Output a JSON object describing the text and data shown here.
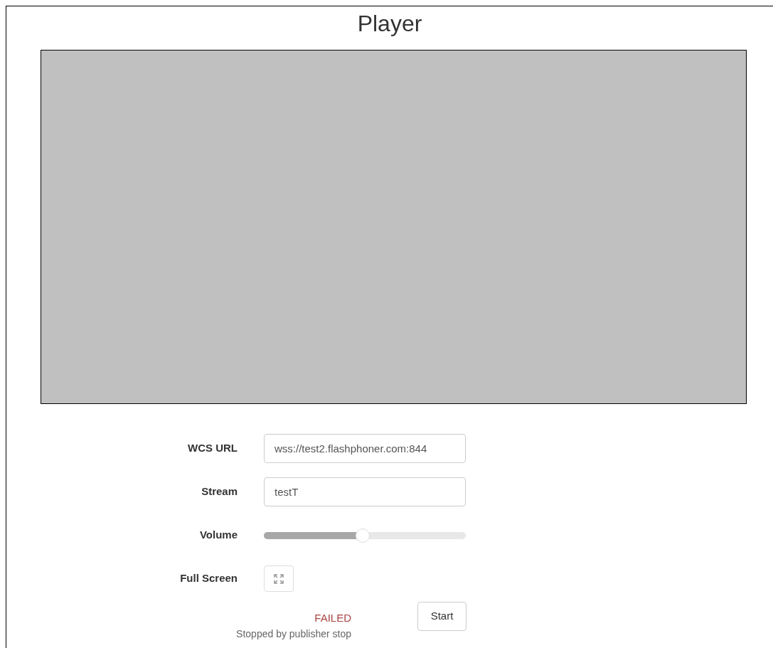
{
  "title": "Player",
  "video": {
    "kind": "empty"
  },
  "form": {
    "wcs_url": {
      "label": "WCS URL",
      "value": "wss://test2.flashphoner.com:844"
    },
    "stream": {
      "label": "Stream",
      "value": "testT"
    },
    "volume": {
      "label": "Volume",
      "level": 0.49
    },
    "full_screen": {
      "label": "Full Screen"
    }
  },
  "status": {
    "state": "FAILED",
    "info": "Stopped by publisher stop"
  },
  "buttons": [
    {
      "label": "Start"
    }
  ]
}
